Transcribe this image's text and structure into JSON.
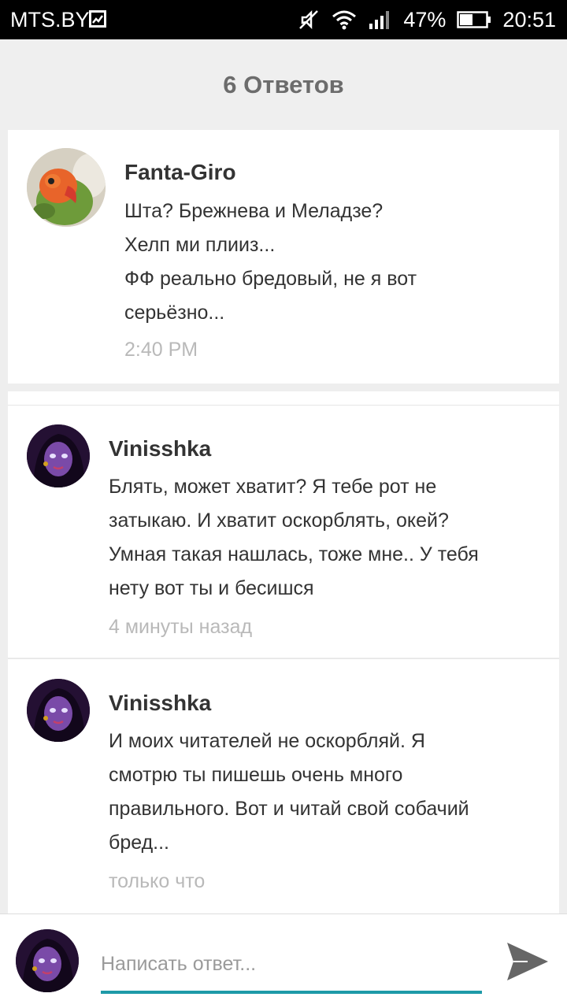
{
  "status_bar": {
    "carrier": "MTS.BY",
    "battery_percent": "47%",
    "time": "20:51",
    "icons": [
      "image-notification-icon",
      "muted-icon",
      "wifi-icon",
      "signal-icon",
      "battery-icon"
    ]
  },
  "header": {
    "title": "6 Ответов"
  },
  "comments": [
    {
      "author": "Fanta-Giro",
      "lines": [
        "Шта? Брежнева и Меладзе?",
        "Хелп ми плииз...",
        "ФФ реально бредовый, не я вот",
        "серьёзно..."
      ],
      "time": "2:40 PM"
    },
    {
      "author": "Vinisshka",
      "lines": [
        "Блять, может хватит? Я тебе рот не",
        "затыкаю. И хватит оскорблять, окей?",
        "Умная такая нашлась, тоже мне.. У тебя",
        "нету вот ты и бесишся"
      ],
      "time": "4 минуты назад"
    },
    {
      "author": "Vinisshka",
      "lines": [
        "И моих читателей не оскорбляй. Я",
        "смотрю ты пишешь очень много",
        "правильного. Вот и читай свой собачий",
        "бред..."
      ],
      "time": "только что"
    }
  ],
  "reply": {
    "placeholder": "Написать ответ...",
    "value": ""
  },
  "colors": {
    "accent": "#1e9aa8",
    "send_icon": "#666666",
    "timestamp": "#b9b9b9"
  }
}
